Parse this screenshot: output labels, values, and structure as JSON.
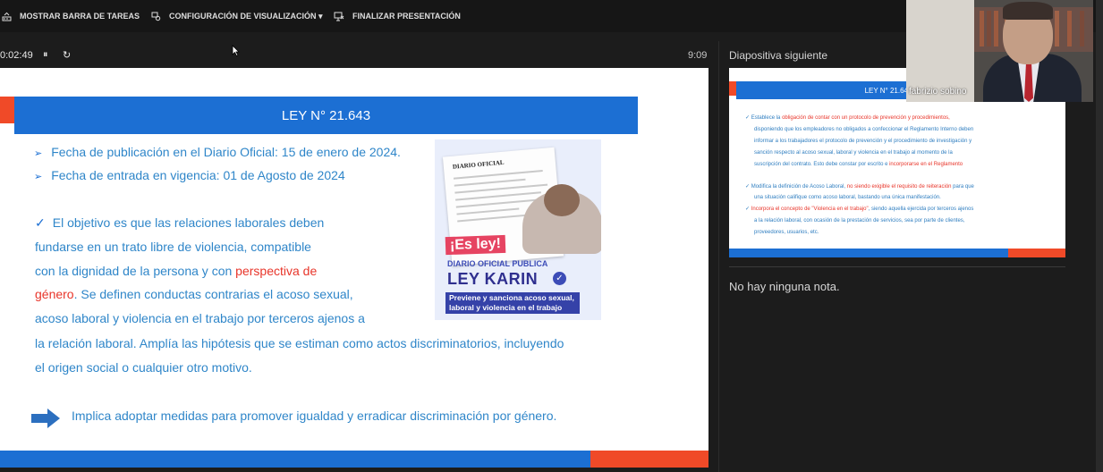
{
  "toolbar": {
    "taskbar": "MOSTRAR BARRA DE TAREAS",
    "display_settings": "CONFIGURACIÓN DE VISUALIZACIÓN ▾",
    "end_show": "FINALIZAR PRESENTACIÓN"
  },
  "controls": {
    "elapsed": "0:02:49",
    "pause": "⏸",
    "restart": "↻",
    "clock": "9:09"
  },
  "slide": {
    "title": "LEY N° 21.643",
    "line1": "Fecha de publicación en el Diario Oficial: 15 de enero de 2024.",
    "line2": "Fecha de entrada en vigencia: 01 de Agosto de 2024",
    "line3": "El objetivo es que las relaciones laborales deben",
    "line4": "fundarse en un trato libre de violencia, compatible",
    "line5a": "con la dignidad de la persona y con ",
    "line5b": "perspectiva de",
    "line6a": "género",
    "line6b": ". Se definen conductas contrarias el acoso sexual,",
    "line7": "acoso laboral y violencia en el trabajo por terceros ajenos a",
    "line8": "la relación laboral. Amplía las hipótesis que se estiman como actos discriminatorios, incluyendo",
    "line9": "el origen social o cualquier otro motivo.",
    "line10": "Implica adoptar medidas para promover igualdad y erradicar discriminación por género.",
    "image": {
      "doc_title": "DIARIO OFICIAL",
      "es_ley": "¡Es ley!",
      "diario": "DIARIO OFICIAL PUBLICA",
      "ley_karin": "LEY KARIN",
      "previene": "Previene y sanciona acoso sexual, laboral y violencia en el trabajo"
    }
  },
  "next": {
    "label": "Diapositiva siguiente",
    "title": "LEY N° 21.643",
    "l1a": "✓ Establece la ",
    "l1b": "obligación de contar con un protocolo de prevención y procedimientos,",
    "l2": "disponiendo que los empleadores no obligados a confeccionar el Reglamento Interno deben",
    "l3": "informar a los trabajadores el protocolo de prevención y el procedimiento de investigación y",
    "l4": "sanción respecto al acoso sexual, laboral y violencia en el trabajo al momento de la",
    "l5a": "suscripción del contrato. Esto debe constar por escrito e ",
    "l5b": "incorporarse en el Reglamento",
    "l6a": "✓ Modifica la definición de Acoso Laboral, ",
    "l6b": "no siendo exigible el requisito de reiteración",
    "l6c": " para que",
    "l7": "una situación califique como acoso laboral, bastando una única manifestación.",
    "l8a": "✓ ",
    "l8b": "Incorpora el concepto de \"Violencia en el trabajo\"",
    "l8c": ", siendo aquella ejercida por terceros ajenos",
    "l9": "a la relación laboral, con ocasión de la prestación de servicios, sea por parte de clientes,",
    "l10": "proveedores, usuarios, etc."
  },
  "notes": {
    "text": "No hay ninguna nota."
  },
  "video": {
    "name": "fabrizio sobino"
  },
  "colors": {
    "blue": "#1c6fd3",
    "red": "#f04a28",
    "text_blue": "#2f86c9"
  }
}
